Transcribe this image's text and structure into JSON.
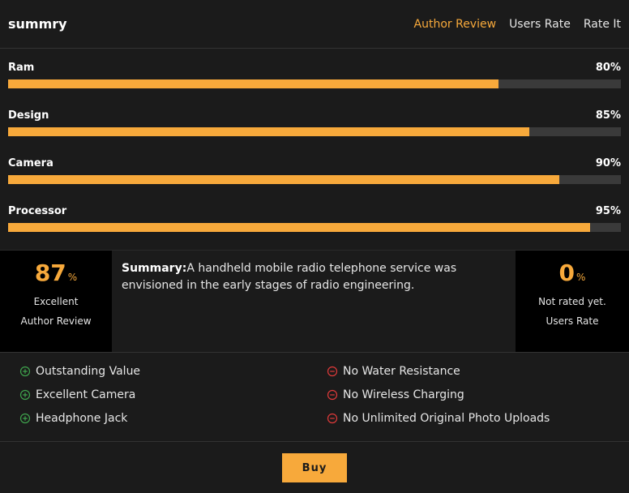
{
  "header": {
    "title": "summry",
    "tabs": [
      {
        "label": "Author Review",
        "active": true
      },
      {
        "label": "Users Rate",
        "active": false
      },
      {
        "label": "Rate It",
        "active": false
      }
    ]
  },
  "ratings": [
    {
      "label": "Ram",
      "value_text": "80%",
      "value": 80
    },
    {
      "label": "Design",
      "value_text": "85%",
      "value": 85
    },
    {
      "label": "Camera",
      "value_text": "90%",
      "value": 90
    },
    {
      "label": "Processor",
      "value_text": "95%",
      "value": 95
    }
  ],
  "author_score": {
    "number": "87",
    "unit": "%",
    "verdict": "Excellent",
    "caption": "Author Review"
  },
  "summary": {
    "heading": "Summary:",
    "text": "A handheld mobile radio telephone service was envisioned in the early stages of radio engineering."
  },
  "users_score": {
    "number": "0",
    "unit": "%",
    "verdict": "Not rated yet.",
    "caption": "Users Rate"
  },
  "pros": [
    "Outstanding Value",
    "Excellent Camera",
    "Headphone Jack"
  ],
  "cons": [
    "No Water Resistance",
    "No Wireless Charging",
    "No Unlimited Original Photo Uploads"
  ],
  "footer": {
    "buy_label": "Buy"
  },
  "colors": {
    "accent": "#f7a93b",
    "pro": "#3fa34d",
    "con": "#e03a3a"
  }
}
